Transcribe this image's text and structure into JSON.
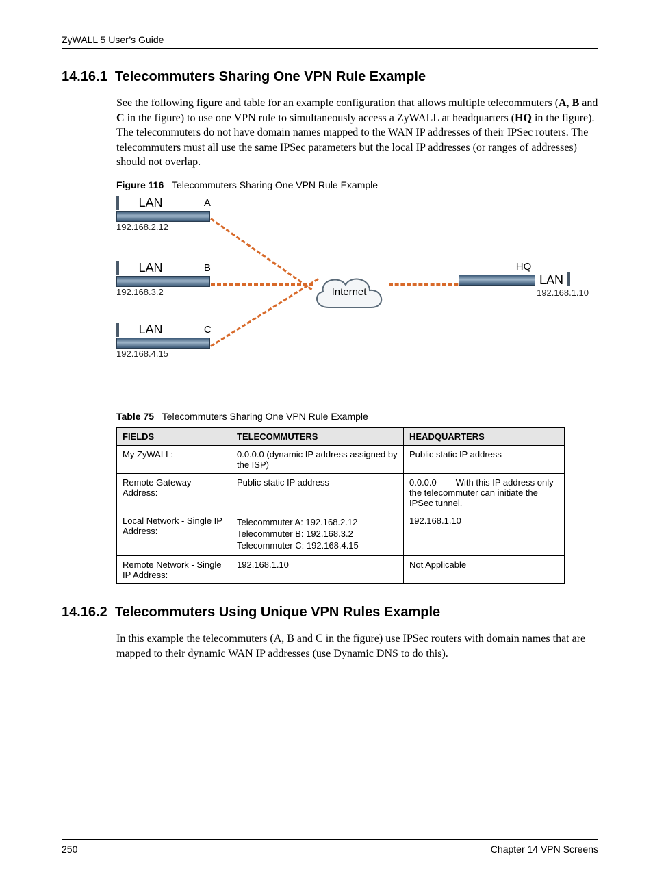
{
  "header": {
    "guide": "ZyWALL 5 User’s Guide"
  },
  "section1": {
    "num": "14.16.1",
    "title": "Telecommuters Sharing One VPN Rule Example",
    "para_parts": [
      "See the following figure and table for an example configuration that allows multiple telecommuters (",
      "A",
      ", ",
      "B",
      " and ",
      "C",
      " in the figure) to use one VPN rule to simultaneously access a ZyWALL at headquarters (",
      "HQ",
      " in the figure). The telecommuters do not have domain names mapped to the WAN IP addresses of their IPSec routers. The telecommuters must all use the same IPSec parameters but the local IP addresses (or ranges of addresses) should not overlap."
    ]
  },
  "figure": {
    "num": "Figure 116",
    "title": "Telecommuters Sharing One VPN Rule Example",
    "lan_label": "LAN",
    "internet_label": "Internet",
    "nodes": {
      "a": {
        "letter": "A",
        "ip": "192.168.2.12"
      },
      "b": {
        "letter": "B",
        "ip": "192.168.3.2"
      },
      "c": {
        "letter": "C",
        "ip": "192.168.4.15"
      },
      "hq": {
        "letter": "HQ",
        "ip": "192.168.1.10"
      }
    }
  },
  "table": {
    "num": "Table 75",
    "title": "Telecommuters Sharing One VPN Rule Example",
    "head": {
      "c1": "FIELDS",
      "c2": "TELECOMMUTERS",
      "c3": "HEADQUARTERS"
    },
    "rows": [
      {
        "c1": "My ZyWALL:",
        "c2": "0.0.0.0 (dynamic IP address assigned by the ISP)",
        "c3": "Public static IP address"
      },
      {
        "c1": "Remote Gateway Address:",
        "c2": "Public static IP address",
        "c3_pre": "0.0.0.0",
        "c3_post": "With this IP address only the telecommuter can initiate the IPSec tunnel."
      },
      {
        "c1": "Local Network - Single IP Address:",
        "c2_lines": [
          "Telecommuter A: 192.168.2.12",
          "Telecommuter B: 192.168.3.2",
          "Telecommuter C: 192.168.4.15"
        ],
        "c3": "192.168.1.10"
      },
      {
        "c1": "Remote Network - Single IP Address:",
        "c2": "192.168.1.10",
        "c3": "Not Applicable"
      }
    ]
  },
  "section2": {
    "num": "14.16.2",
    "title": "Telecommuters Using Unique VPN Rules Example",
    "para": "In this example the telecommuters (A, B and C in the figure) use IPSec routers with domain names that are mapped to their dynamic WAN IP addresses (use Dynamic DNS to do this)."
  },
  "footer": {
    "page": "250",
    "chapter": "Chapter 14 VPN Screens"
  }
}
